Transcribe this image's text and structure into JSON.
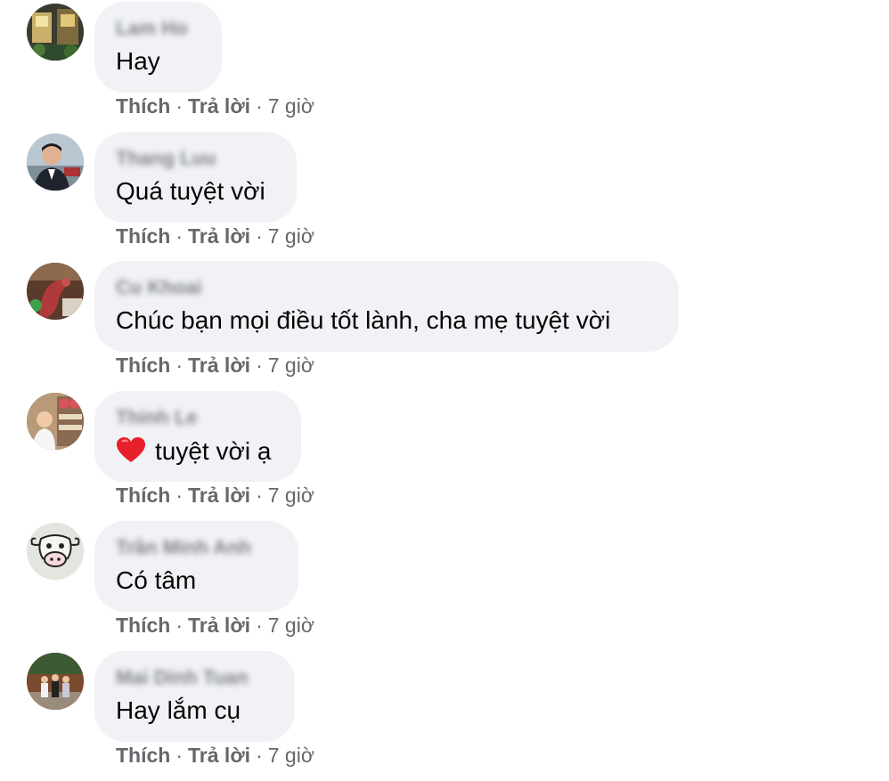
{
  "labels": {
    "like": "Thích",
    "reply": "Trả lời",
    "separator": "·"
  },
  "comments": [
    {
      "author": "Lam Ho",
      "text": "Hay",
      "time": "7 giờ",
      "avatar": "storefront-photo"
    },
    {
      "author": "Thang Luu",
      "text": "Quá tuyệt vời",
      "time": "7 giờ",
      "avatar": "man-in-suit-photo"
    },
    {
      "author": "Cu Khoai",
      "text": "Chúc bạn mọi điều tốt lành, cha mẹ tuyệt vời",
      "time": "7 giờ",
      "avatar": "bird-statue-photo"
    },
    {
      "author": "Thinh Le",
      "text": "tuyệt vời ạ",
      "emoji": "heart-emoji",
      "time": "7 giờ",
      "avatar": "child-photo"
    },
    {
      "author": "Trần Minh Anh",
      "text": "Có tâm",
      "time": "7 giờ",
      "avatar": "cow-drawing"
    },
    {
      "author": "Mai Dinh Tuan",
      "text": "Hay lắm cụ",
      "time": "7 giờ",
      "avatar": "group-photo"
    }
  ],
  "colors": {
    "bubble": "#f0f2f5",
    "meta_text": "#65676b",
    "heart": "#e8202c"
  }
}
